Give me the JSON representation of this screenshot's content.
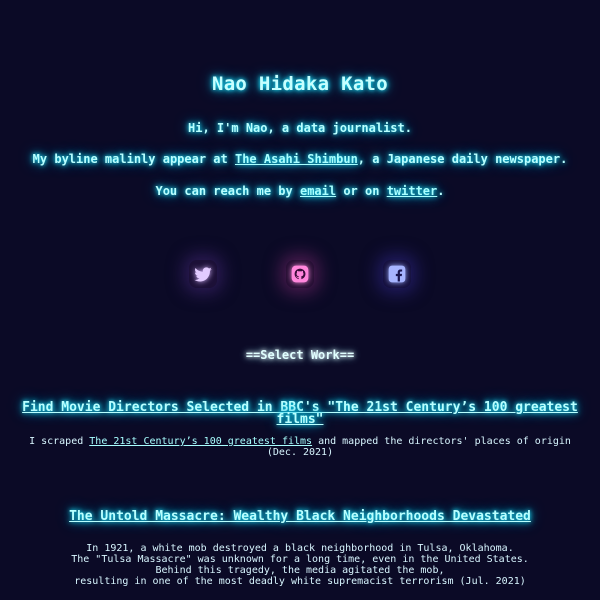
{
  "header": {
    "title": "Nao Hidaka Kato"
  },
  "intro": {
    "line1": "Hi, I'm Nao, a data journalist.",
    "line2_prefix": "My byline malinly appear at ",
    "line2_link": "The Asahi Shimbun",
    "line2_suffix": ", a Japanese daily newspaper.",
    "line3_prefix": "You can reach me by ",
    "line3_link1": "email",
    "line3_middle": " or on ",
    "line3_link2": "twitter",
    "line3_suffix": "."
  },
  "social": {
    "icons": [
      "twitter-icon",
      "github-icon",
      "facebook-icon"
    ],
    "colors": {
      "twitter": "#c9a8ff",
      "github": "#ff7ad6",
      "facebook": "#8fa0ff"
    }
  },
  "section": {
    "heading": "==Select Work=="
  },
  "works": [
    {
      "title": "Find Movie Directors Selected in BBC's \"The 21st Century’s 100 greatest films\"",
      "desc_prefix": "I scraped ",
      "desc_link": "The 21st Century’s 100 greatest films",
      "desc_suffix": " and mapped the directors' places of origin",
      "date": "(Dec. 2021)"
    },
    {
      "title": "The Untold Massacre: Wealthy Black Neighborhoods Devastated",
      "desc_line1": "In 1921, a white mob destroyed a black neighborhood in Tulsa, Oklahoma.",
      "desc_line2": "The \"Tulsa Massacre\" was unknown for a long time, even in the United States.",
      "desc_line3": "Behind this tragedy, the media agitated the mob,",
      "desc_line4": "resulting in one of the most deadly white supremacist terrorism (Jul. 2021)"
    }
  ],
  "theme": {
    "background": "#0b0a26",
    "text_glow": "#1ee6ff"
  }
}
